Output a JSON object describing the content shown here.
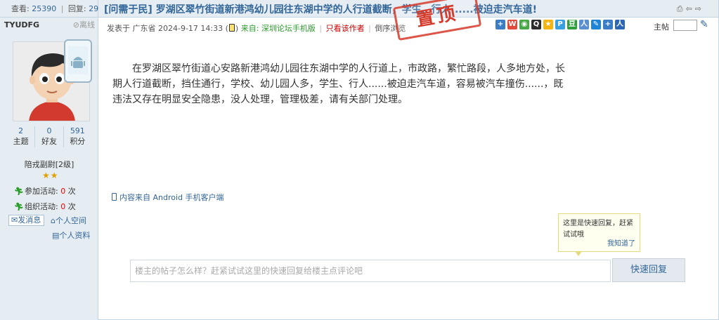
{
  "left": {
    "view_label": "查看:",
    "views": "25390",
    "reply_label": "回复:",
    "replies": "29",
    "author": "TYUDFG",
    "offline": "离线",
    "counts": [
      {
        "value": "2",
        "label": "主题"
      },
      {
        "value": "0",
        "label": "好友"
      },
      {
        "value": "591",
        "label": "积分"
      }
    ],
    "rank": "陪戎副尉[2级]",
    "activities": [
      {
        "label": "参加活动:",
        "count": "0",
        "unit": "次"
      },
      {
        "label": "组织活动:",
        "count": "0",
        "unit": "次"
      }
    ],
    "send_message": "发消息",
    "personal_space": "个人空间",
    "personal_profile": "个人资料"
  },
  "post": {
    "title": "[问需于民] 罗湖区翠竹街道新港鸿幼儿园往东湖中学的人行道截断，学生、行人......被迫走汽车道!",
    "meta_prefix": "发表于 广东省 2024-9-17 14:33",
    "meta_from": "来自: 深圳论坛手机版",
    "only_author": "只看该作者",
    "reverse_order": "倒序浏览",
    "stamp": "置顶",
    "floor_label": "主帖",
    "body": "在罗湖区翠竹街道心安路新港鸿幼儿园往东湖中学的人行道上，市政路，繁忙路段，人多地方处，长期人行道截断，挡住通行，学校、幼儿园人多，学生、行人......被迫走汽车道，容易被汽车撞伤......，既违法又存在明显安全隐患，没人处理，管理极差，请有关部门处理。",
    "source": "内容来自 Android 手机客户端"
  },
  "quick_reply": {
    "tip": "这里是快速回复，赶紧试试哦",
    "tip_ok": "我知道了",
    "placeholder": "楼主的帖子怎么样？赶紧试试这里的快速回复给楼主点评论吧",
    "button": "快速回复"
  },
  "icons": [
    "print-icon",
    "prev-icon",
    "next-icon",
    "mobile-icon",
    "avatar-image",
    "android-icon",
    "star-icon",
    "run-icon",
    "mail-icon",
    "home-icon",
    "profile-icon",
    "share-icons",
    "go-icon"
  ],
  "colors": {
    "accent": "#336699",
    "header_bg": "#e5edf2",
    "border": "#c2d5e3",
    "stamp": "#d63a2a"
  }
}
